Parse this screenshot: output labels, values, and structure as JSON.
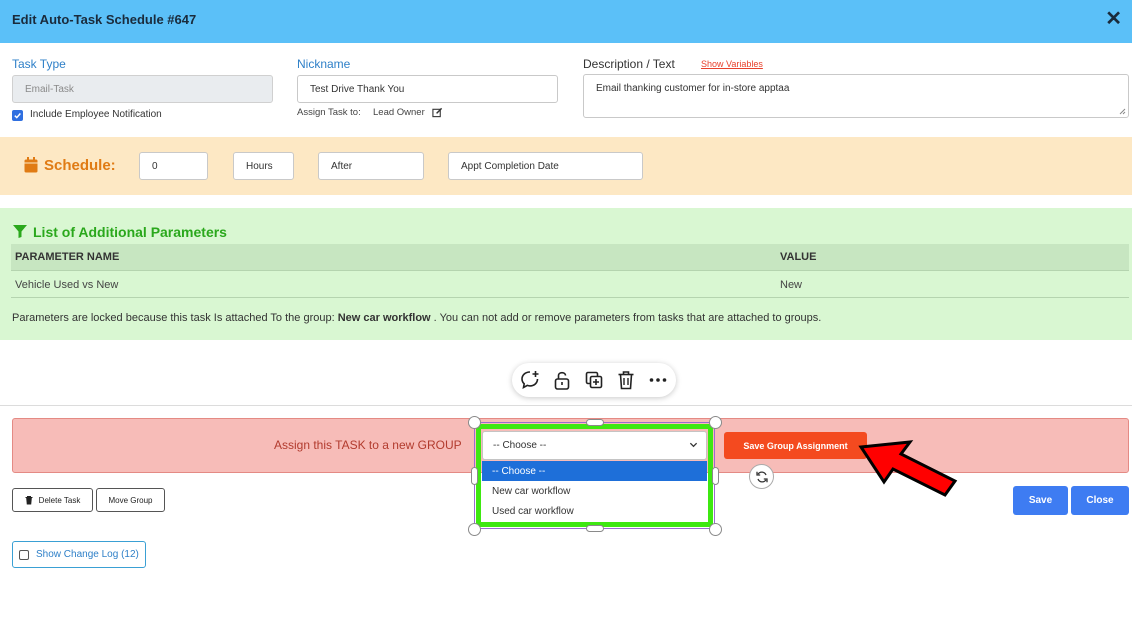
{
  "window": {
    "title": "Edit Auto-Task Schedule #647",
    "close_glyph": "✕"
  },
  "task_type": {
    "label": "Task Type",
    "value": "Email-Task"
  },
  "include_notification": {
    "label": "Include Employee Notification",
    "checked": true
  },
  "nickname": {
    "label": "Nickname",
    "value": "Test Drive Thank You"
  },
  "assign_task": {
    "label": "Assign Task to:",
    "value": "Lead Owner"
  },
  "description": {
    "label": "Description / Text",
    "link": "Show Variables",
    "value": "Email thanking customer for in-store apptaa"
  },
  "schedule": {
    "label": "Schedule:",
    "amount": "0",
    "unit": "Hours",
    "relation": "After",
    "reference": "Appt Completion Date"
  },
  "params": {
    "heading": "List of Additional Parameters",
    "columns": [
      "PARAMETER NAME",
      "VALUE"
    ],
    "rows": [
      {
        "name": "Vehicle Used vs New",
        "value": "New"
      }
    ],
    "note_before": "Parameters are locked because this task Is attached To the group: ",
    "note_group": "New car workflow",
    "note_after": " . You can not add or remove parameters from tasks that are attached to groups."
  },
  "assign_group": {
    "label": "Assign this TASK to a new GROUP",
    "selected": "-- Choose --",
    "options": [
      "-- Choose --",
      "New car workflow",
      "Used car workflow"
    ],
    "save_button": "Save Group Assignment"
  },
  "buttons": {
    "delete_task": "Delete Task",
    "move_group": "Move Group",
    "save": "Save",
    "close": "Close",
    "change_log": "Show Change Log (12)"
  },
  "colors": {
    "titlebar": "#5bc0f8",
    "schedule_bg": "#fde8c4",
    "params_bg": "#d9f7d2",
    "assign_bg": "#f7bcb8",
    "save_group": "#f44a1f",
    "primary": "#3e7cf2",
    "highlight": "#3ee811",
    "arrow": "#ff0000"
  },
  "icons": [
    "comment-add-icon",
    "unlock-icon",
    "duplicate-icon",
    "trash-icon",
    "more-icon",
    "rotate-icon",
    "calendar-icon",
    "filter-icon",
    "edit-icon",
    "chevron-down-icon",
    "red-arrow-icon"
  ]
}
